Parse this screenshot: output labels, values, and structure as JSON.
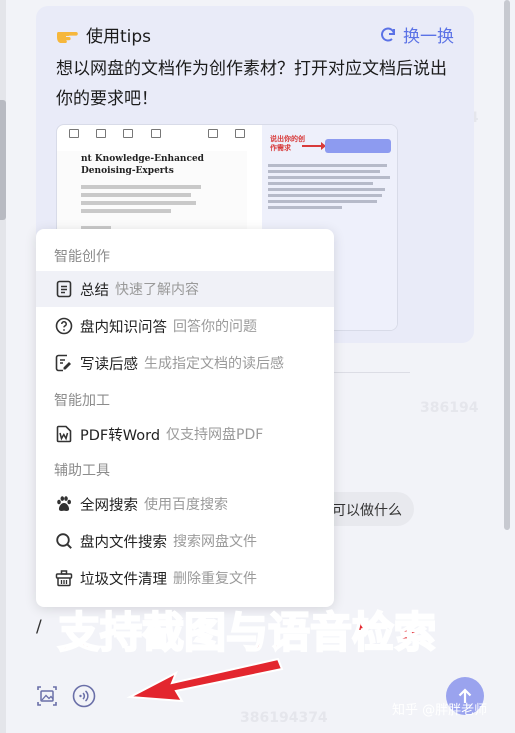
{
  "tips": {
    "icon": "pointing-hand-icon",
    "title": "使用tips",
    "refresh_label": "换一换",
    "text": "想以网盘的文档作为创作素材？打开对应文档后说出你的要求吧！",
    "preview": {
      "red_note": "说出你的创作需求",
      "doc_title": "nt Knowledge-Enhanced Denoising-Experts"
    }
  },
  "chip": {
    "text": "可以做什么"
  },
  "menu": {
    "sections": [
      {
        "title": "智能创作",
        "items": [
          {
            "label": "总结",
            "desc": "快速了解内容",
            "icon": "document-icon"
          },
          {
            "label": "盘内知识问答",
            "desc": "回答你的问题",
            "icon": "question-icon"
          },
          {
            "label": "写读后感",
            "desc": "生成指定文档的读后感",
            "icon": "pen-doc-icon"
          }
        ]
      },
      {
        "title": "智能加工",
        "items": [
          {
            "label": "PDF转Word",
            "desc": "仅支持网盘PDF",
            "icon": "word-icon"
          }
        ]
      },
      {
        "title": "辅助工具",
        "items": [
          {
            "label": "全网搜索",
            "desc": "使用百度搜索",
            "icon": "baidu-paw-icon"
          },
          {
            "label": "盘内文件搜索",
            "desc": "搜索网盘文件",
            "icon": "search-icon"
          },
          {
            "label": "垃圾文件清理",
            "desc": "删除重复文件",
            "icon": "trash-icon"
          }
        ]
      }
    ]
  },
  "input": {
    "value": "/"
  },
  "annotation": {
    "text": "支持截图与语音检索",
    "color": "#e3262e"
  },
  "footer": {
    "watermark": "知乎 @胖胖老师"
  },
  "colors": {
    "accent": "#5b72e6",
    "send_button": "#9aa3ee",
    "card": "#e9ebf8"
  }
}
